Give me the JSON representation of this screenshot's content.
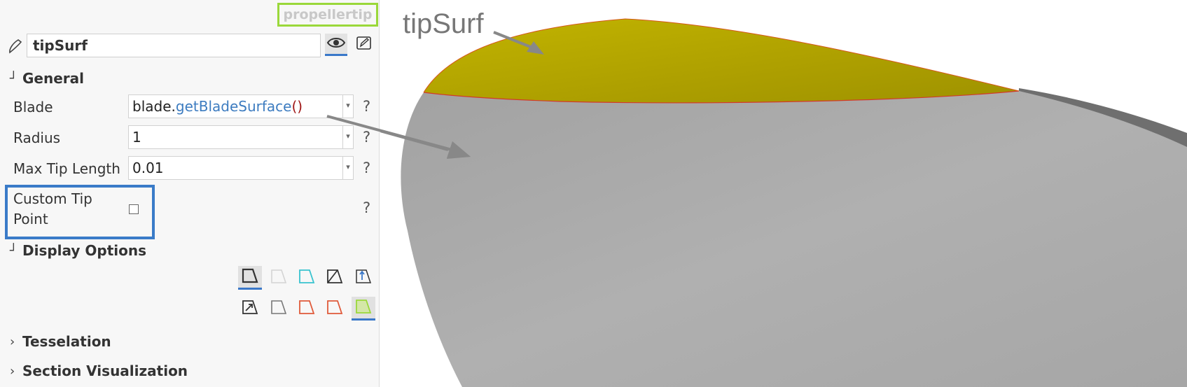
{
  "header": {
    "tag": "propellertip"
  },
  "object": {
    "name": "tipSurf"
  },
  "sections": {
    "general": "General",
    "display": "Display Options",
    "tesselation": "Tesselation",
    "section_vis": "Section Visualization"
  },
  "fields": {
    "blade": {
      "label": "Blade",
      "prefix": "blade.",
      "func": "getBladeSurface",
      "parens": "()"
    },
    "radius": {
      "label": "Radius",
      "value": "1"
    },
    "max_tip": {
      "label": "Max Tip Length",
      "value": "0.01"
    },
    "custom_tip": {
      "label": "Custom Tip Point",
      "checked": false
    }
  },
  "help": "?",
  "viewport": {
    "annotation": "tipSurf",
    "tip_color": "#b8ab00",
    "blade_color": "#a9a9a9"
  },
  "colors": {
    "accent": "#3a78c9",
    "tag_border": "#9ad83a",
    "highlight_box": "#3a7bc8"
  },
  "display_icons": [
    "surface-shaded-icon",
    "surface-ghost-icon",
    "surface-cyan-outline-icon",
    "surface-diagonal-icon",
    "surface-normal-icon",
    "surface-arrow-icon",
    "surface-outline-icon",
    "surface-red-outline-icon",
    "surface-red-outline-2-icon",
    "surface-green-fill-icon"
  ]
}
